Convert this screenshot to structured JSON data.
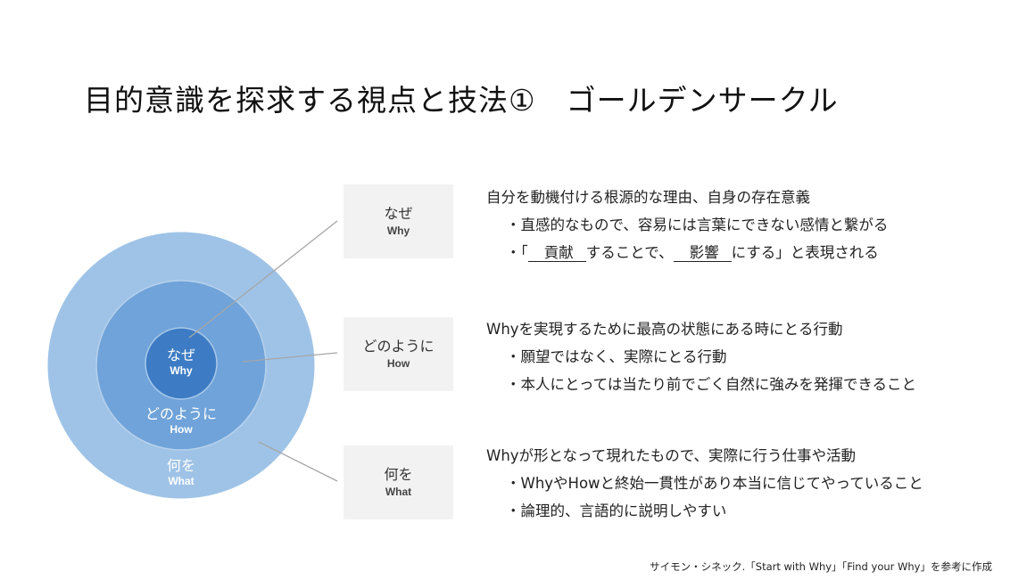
{
  "slide": {
    "title": "目的意識を探求する視点と技法①　ゴールデンサークル",
    "colors": {
      "outer_circle": "#9fc3e7",
      "middle_circle": "#6fa3d9",
      "inner_circle": "#3d7cc4",
      "label_box": "#f2f2f2",
      "connector": "#a6a6a6"
    },
    "circle_labels": {
      "why": {
        "jp": "なぜ",
        "en": "Why"
      },
      "how": {
        "jp": "どのように",
        "en": "How"
      },
      "what": {
        "jp": "何を",
        "en": "What"
      }
    },
    "boxes": [
      {
        "jp": "なぜ",
        "en": "Why"
      },
      {
        "jp": "どのように",
        "en": "How"
      },
      {
        "jp": "何を",
        "en": "What"
      }
    ],
    "descriptions": [
      {
        "heading": "自分を動機付ける根源的な理由、自身の存在意義",
        "bullets": [
          {
            "text": "・直感的なもので、容易には言葉にできない感情と繋がる"
          },
          {
            "prefix": "・「",
            "blank1": "貢献",
            "middle": "することで、",
            "blank2": "影響",
            "suffix": "にする」と表現される"
          }
        ]
      },
      {
        "heading": "Whyを実現するために最高の状態にある時にとる行動",
        "bullets": [
          {
            "text": "・願望ではなく、実際にとる行動"
          },
          {
            "text": "・本人にとっては当たり前でごく自然に強みを発揮できること"
          }
        ]
      },
      {
        "heading": "Whyが形となって現れたもので、実際に行う仕事や活動",
        "bullets": [
          {
            "text": "・WhyやHowと終始一貫性があり本当に信じてやっていること"
          },
          {
            "text": "・論理的、言語的に説明しやすい"
          }
        ]
      }
    ],
    "footer": "サイモン・シネック.「Start with Why」「Find your Why」を参考に作成"
  }
}
